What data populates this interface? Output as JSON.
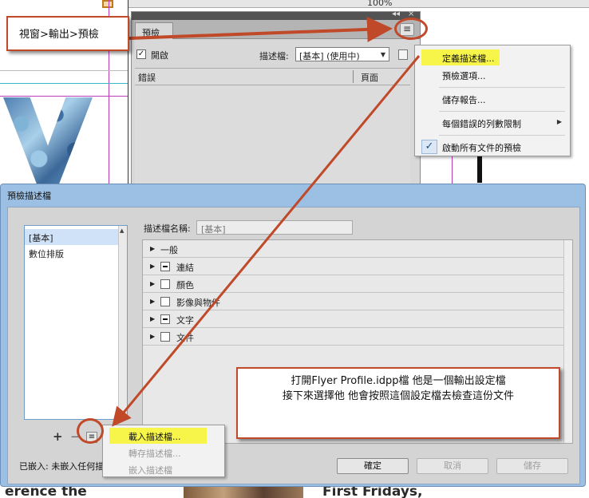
{
  "background": {
    "zoom": "100%",
    "bottom_text_left": "erence the",
    "bottom_text_right": "First Fridays,"
  },
  "preflight_panel": {
    "tab": "預檢",
    "panel_controls": {
      "collapse": "◂◂",
      "close": "×"
    },
    "menu_button_icon": "hamburger-menu-icon",
    "enable_label": "開啟",
    "profile_label": "描述檔:",
    "profile_value": "[基本] (使用中)",
    "columns": [
      "錯誤",
      "頁面"
    ]
  },
  "panel_menu": {
    "items": [
      {
        "label": "定義描述檔...",
        "highlight": true
      },
      {
        "label": "預檢選項..."
      },
      {
        "label": "儲存報告..."
      },
      {
        "label": "每個錯誤的列數限制",
        "submenu": true
      },
      {
        "label": "啟動所有文件的預檢",
        "checked": true
      }
    ],
    "check_glyph": "✓"
  },
  "dialog": {
    "title": "預檢描述檔",
    "profiles": [
      "[基本]",
      "數位排版"
    ],
    "profile_name_label": "描述檔名稱:",
    "profile_name_value": "[基本]",
    "categories": [
      {
        "label": "一般",
        "checkbox": "none"
      },
      {
        "label": "連結",
        "checkbox": "mixed"
      },
      {
        "label": "顏色",
        "checkbox": "empty"
      },
      {
        "label": "影像與物件",
        "checkbox": "empty"
      },
      {
        "label": "文字",
        "checkbox": "mixed"
      },
      {
        "label": "文件",
        "checkbox": "empty"
      }
    ],
    "add_button": "+",
    "remove_button": "−",
    "loaded_label": "已嵌入: 未嵌入任何描",
    "ok_button": "確定",
    "cancel_button": "取消",
    "save_button": "儲存"
  },
  "dialog_menu": {
    "items": [
      {
        "label": "載入描述檔...",
        "highlight": true
      },
      {
        "label": "轉存描述檔...",
        "disabled": true
      },
      {
        "label": "嵌入描述檔",
        "disabled": true
      }
    ]
  },
  "annotations": {
    "top_note": "視窗>輸出>預檢",
    "right_note_line1": "打開Flyer Profile.idpp檔 他是一個輸出設定檔",
    "right_note_line2": "接下來選擇他 他會按照這個設定檔去檢查這份文件"
  },
  "colors": {
    "annotation_red": "#c0492a",
    "highlight_yellow": "#f7f54a",
    "dialog_frame": "#9cc0e4",
    "guide_magenta": "#b93bb9"
  }
}
